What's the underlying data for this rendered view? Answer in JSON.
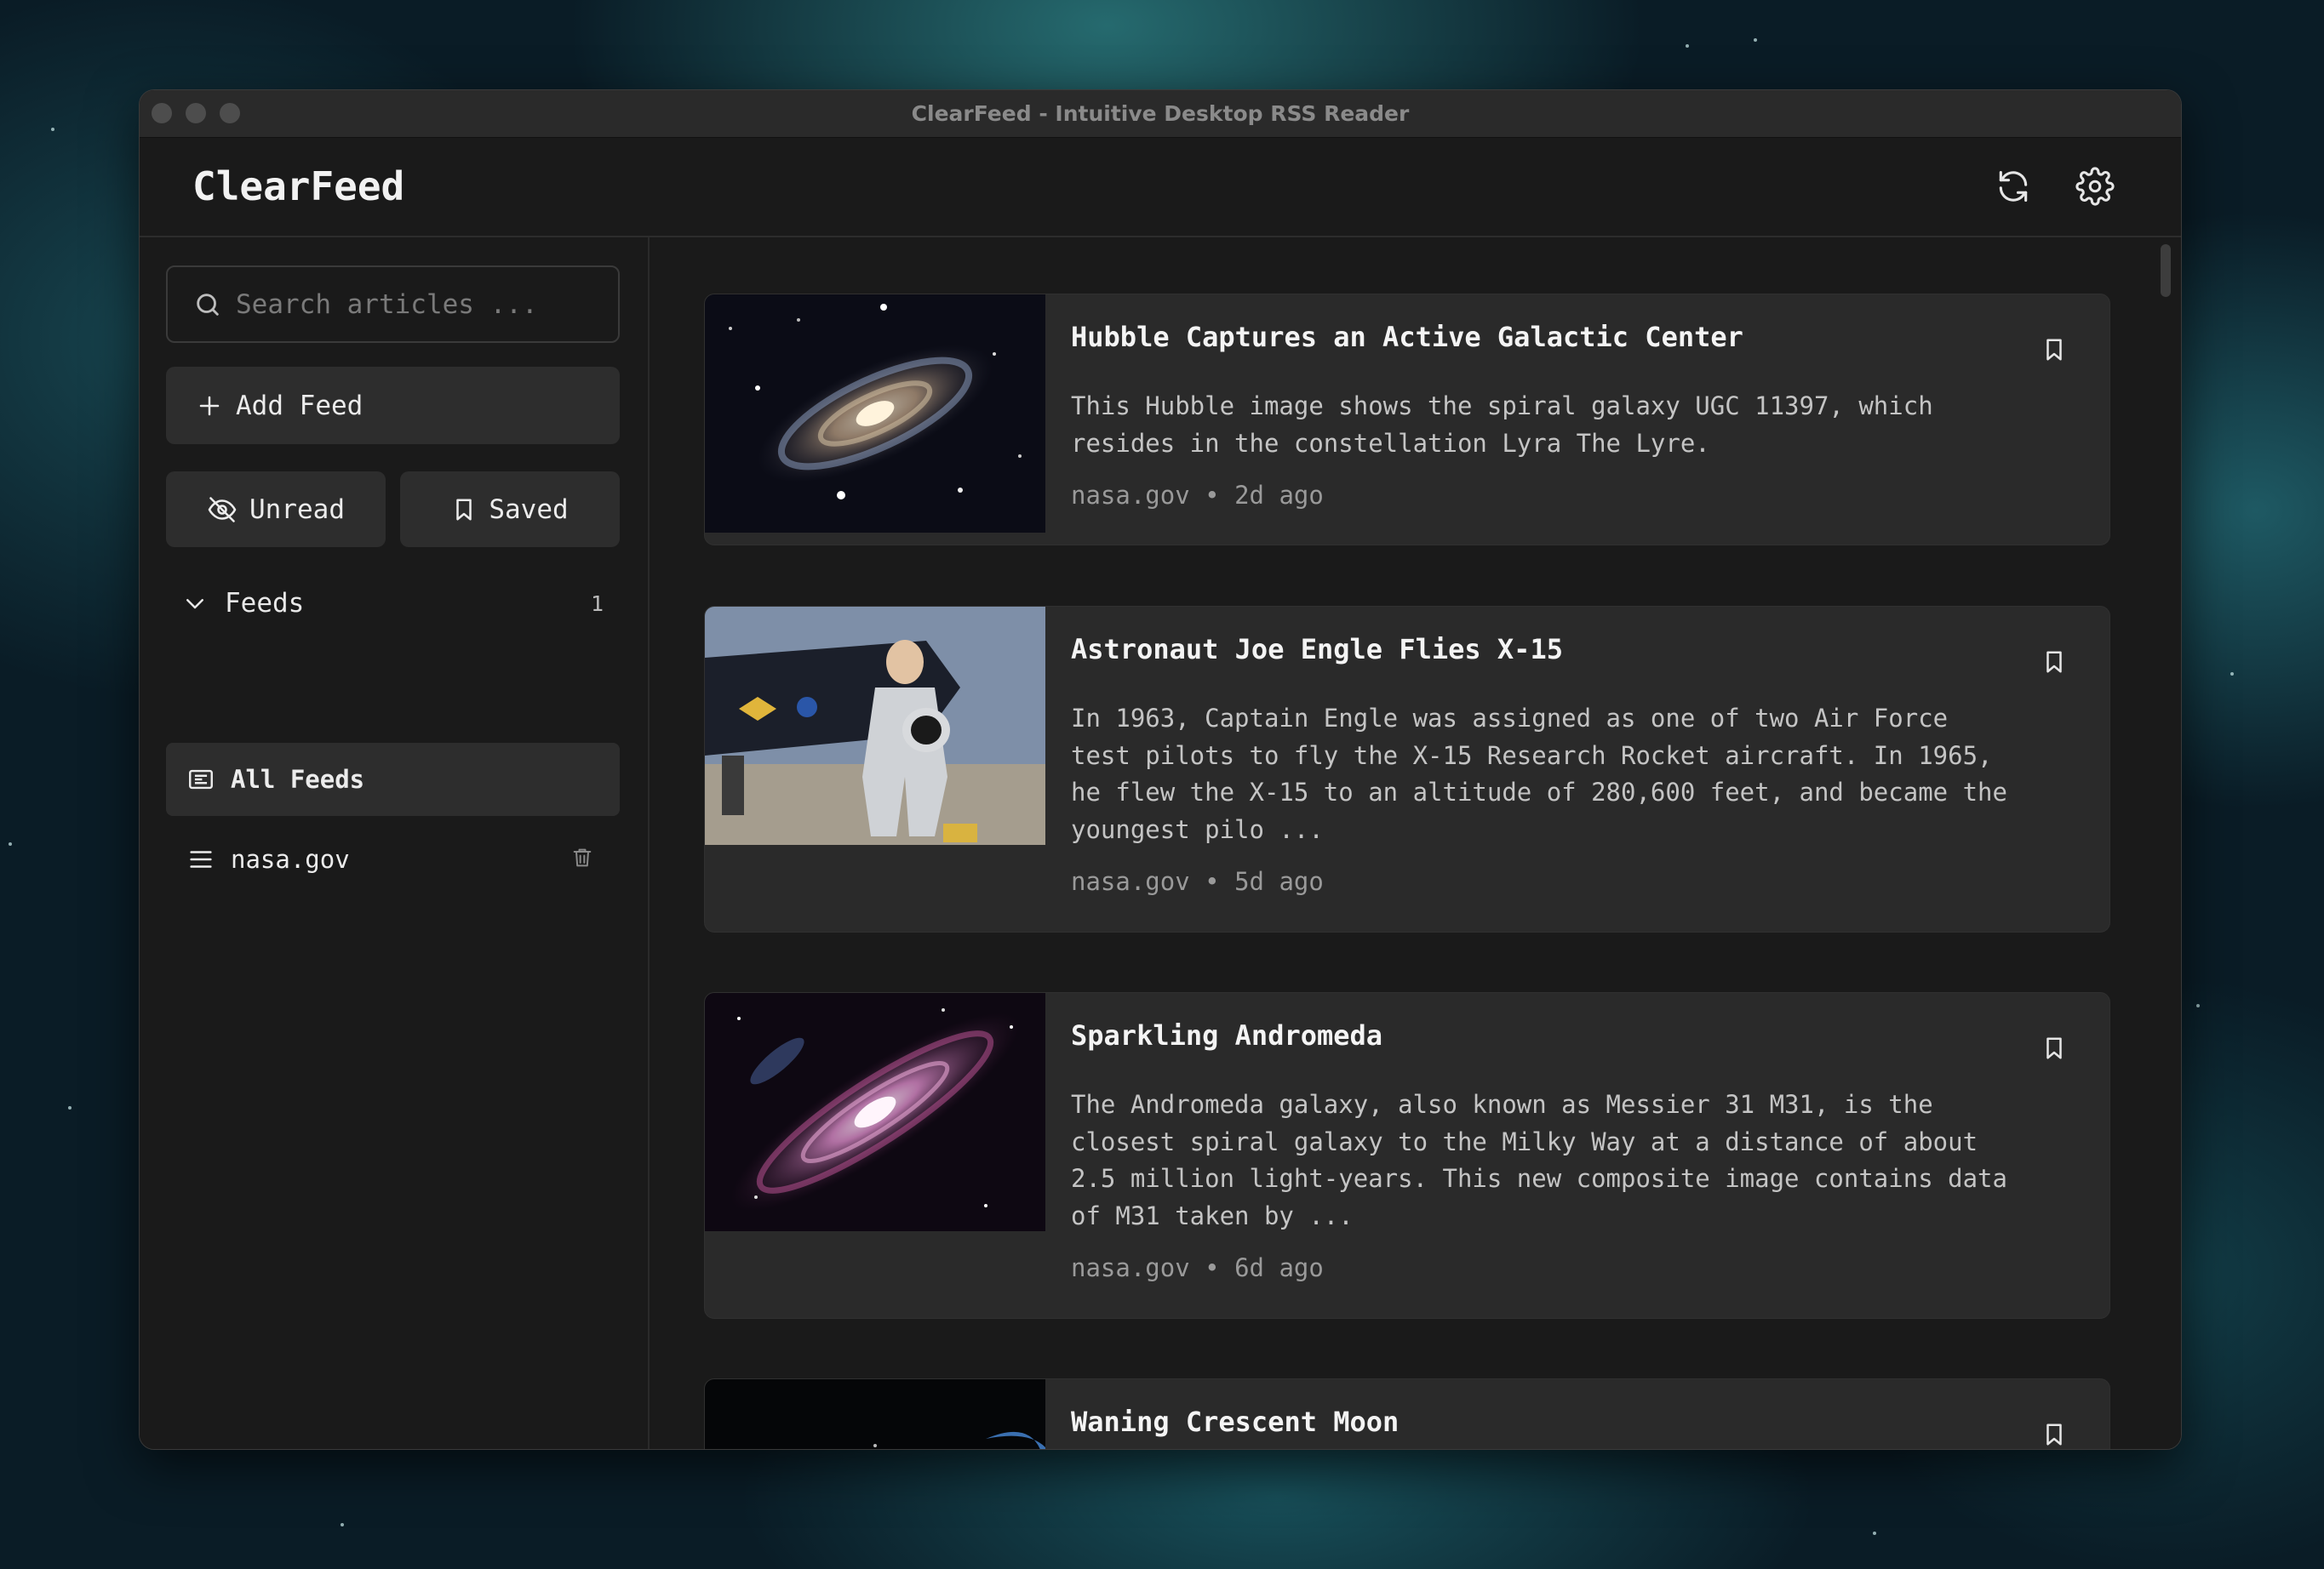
{
  "window": {
    "title": "ClearFeed - Intuitive Desktop RSS Reader"
  },
  "header": {
    "app_name": "ClearFeed",
    "refresh_icon": "refresh-icon",
    "settings_icon": "gear-icon"
  },
  "sidebar": {
    "search_placeholder": "Search articles ...",
    "add_feed_label": "Add Feed",
    "unread_label": "Unread",
    "saved_label": "Saved",
    "feeds_label": "Feeds",
    "feeds_count": "1",
    "items": [
      {
        "label": "All Feeds",
        "icon": "newspaper-icon",
        "active": true
      },
      {
        "label": "nasa.gov",
        "icon": "menu-lines-icon",
        "active": false
      }
    ]
  },
  "articles": [
    {
      "title": "Hubble Captures an Active Galactic Center",
      "description": "This Hubble image shows the spiral galaxy UGC 11397, which resides in the constellation Lyra The Lyre.",
      "source": "nasa.gov",
      "age": "2d ago"
    },
    {
      "title": "Astronaut Joe Engle Flies X-15",
      "description": "In 1963, Captain Engle was assigned as one of two Air Force test pilots to fly the X-15 Research Rocket aircraft. In 1965, he flew the X-15 to an altitude of 280,600 feet, and became the youngest pilo ...",
      "source": "nasa.gov",
      "age": "5d ago"
    },
    {
      "title": "Sparkling Andromeda",
      "description": "The Andromeda galaxy, also known as Messier 31 M31, is the closest spiral galaxy to the Milky Way at a distance of about 2.5 million light-years. This new composite image contains data of M31 taken by ...",
      "source": "nasa.gov",
      "age": "6d ago"
    },
    {
      "title": "Waning Crescent Moon",
      "description": "",
      "source": "",
      "age": ""
    }
  ],
  "meta_separator": "•"
}
